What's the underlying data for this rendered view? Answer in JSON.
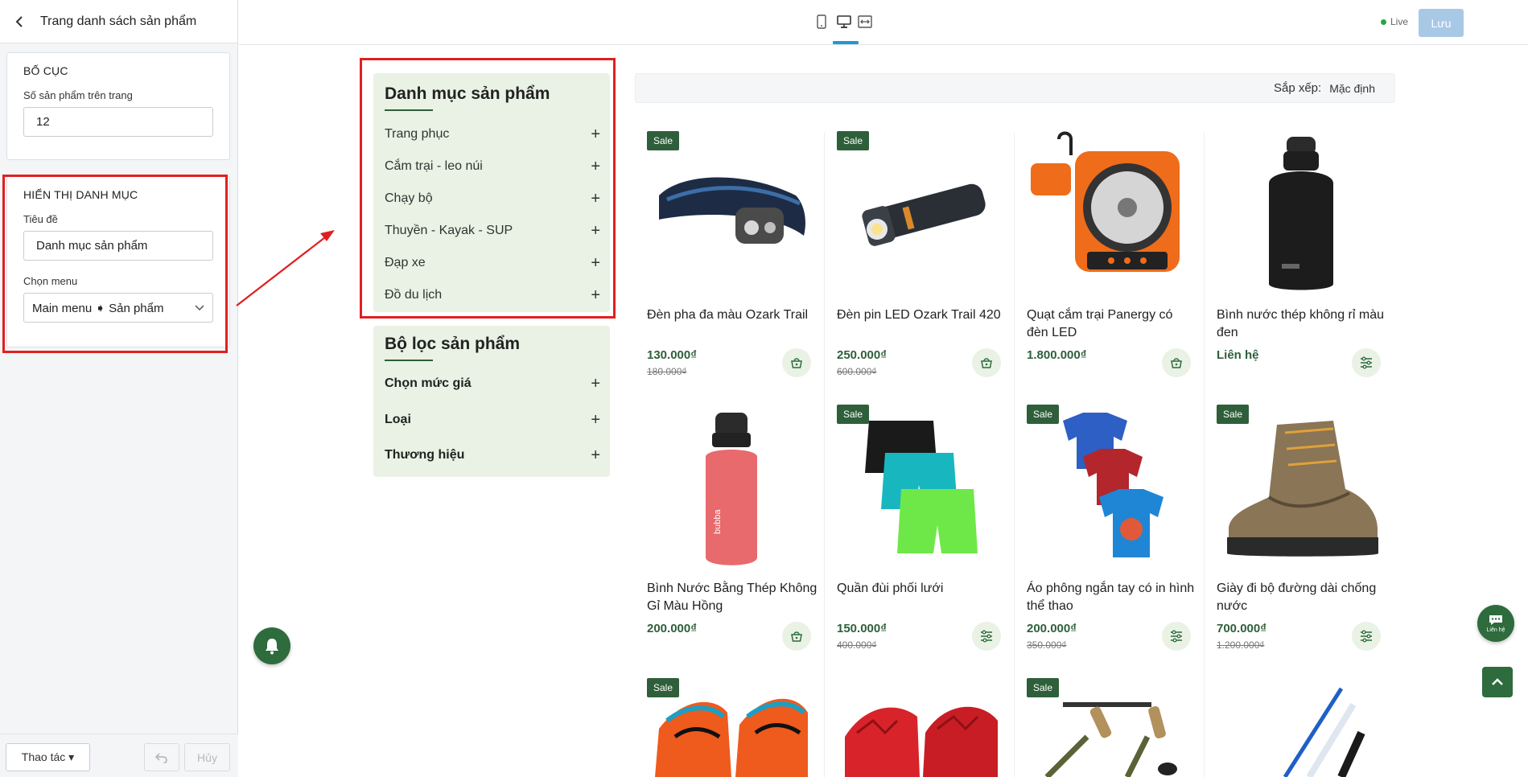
{
  "sidebar": {
    "title": "Trang danh sách sản phẩm",
    "layout_section": {
      "heading": "BỐ CỤC",
      "per_page_label": "Số sản phẩm trên trang",
      "per_page_value": "12"
    },
    "category_section": {
      "heading": "HIỂN THỊ DANH MỤC",
      "title_label": "Tiêu đề",
      "title_value": "Danh mục sản phẩm",
      "menu_label": "Chọn menu",
      "menu_value": "Main menu ➧ Sản phẩm"
    },
    "footer": {
      "actions_label": "Thao tác ▾",
      "cancel_label": "Hủy"
    }
  },
  "topbar": {
    "live_label": "Live",
    "save_label": "Lưu",
    "devices": [
      "mobile-icon",
      "desktop-icon",
      "fullwidth-icon"
    ],
    "active_device": "desktop"
  },
  "categories": {
    "title": "Danh mục sản phẩm",
    "items": [
      "Trang phục",
      "Cắm trại - leo núi",
      "Chạy bộ",
      "Thuyền - Kayak - SUP",
      "Đạp xe",
      "Đồ du lịch"
    ]
  },
  "filters": {
    "title": "Bộ lọc sản phẩm",
    "items": [
      "Chọn mức giá",
      "Loại",
      "Thương hiệu"
    ]
  },
  "sort": {
    "label": "Sắp xếp:",
    "value": "Mặc định"
  },
  "products": [
    {
      "name": "Đèn pha đa màu Ozark Trail",
      "price": "130.000₫",
      "old_price": "180.000₫",
      "sale": "Sale",
      "action": "cart-icon"
    },
    {
      "name": "Đèn pin LED Ozark Trail 420",
      "price": "250.000₫",
      "old_price": "600.000₫",
      "sale": "Sale",
      "action": "cart-icon"
    },
    {
      "name": "Quạt cắm trại Panergy có đèn LED",
      "price": "1.800.000₫",
      "old_price": "",
      "sale": "",
      "action": "cart-icon"
    },
    {
      "name": "Bình nước thép không rỉ màu đen",
      "price": "Liên hệ",
      "old_price": "",
      "sale": "",
      "action": "options-icon"
    },
    {
      "name": "Bình Nước Bằng Thép Không Gỉ Màu Hồng",
      "price": "200.000₫",
      "old_price": "",
      "sale": "",
      "action": "cart-icon"
    },
    {
      "name": "Quần đùi phối lưới",
      "price": "150.000₫",
      "old_price": "400.000₫",
      "sale": "Sale",
      "action": "options-icon"
    },
    {
      "name": "Áo phông ngắn tay có in hình thể thao",
      "price": "200.000₫",
      "old_price": "350.000₫",
      "sale": "Sale",
      "action": "options-icon"
    },
    {
      "name": "Giày đi bộ đường dài chống nước",
      "price": "700.000₫",
      "old_price": "1.200.000₫",
      "sale": "Sale",
      "action": "options-icon"
    },
    {
      "name": "",
      "price": "",
      "old_price": "",
      "sale": "Sale",
      "action": ""
    },
    {
      "name": "",
      "price": "",
      "old_price": "",
      "sale": "",
      "action": ""
    },
    {
      "name": "",
      "price": "",
      "old_price": "",
      "sale": "Sale",
      "action": ""
    },
    {
      "name": "",
      "price": "",
      "old_price": "",
      "sale": "",
      "action": ""
    }
  ],
  "floating": {
    "contact_label": "Liên hệ"
  },
  "colors": {
    "brand_green": "#2e6b3d",
    "category_bg": "#e9f2e4",
    "highlight_red": "#e02020",
    "accent_blue": "#1f9ad6"
  }
}
